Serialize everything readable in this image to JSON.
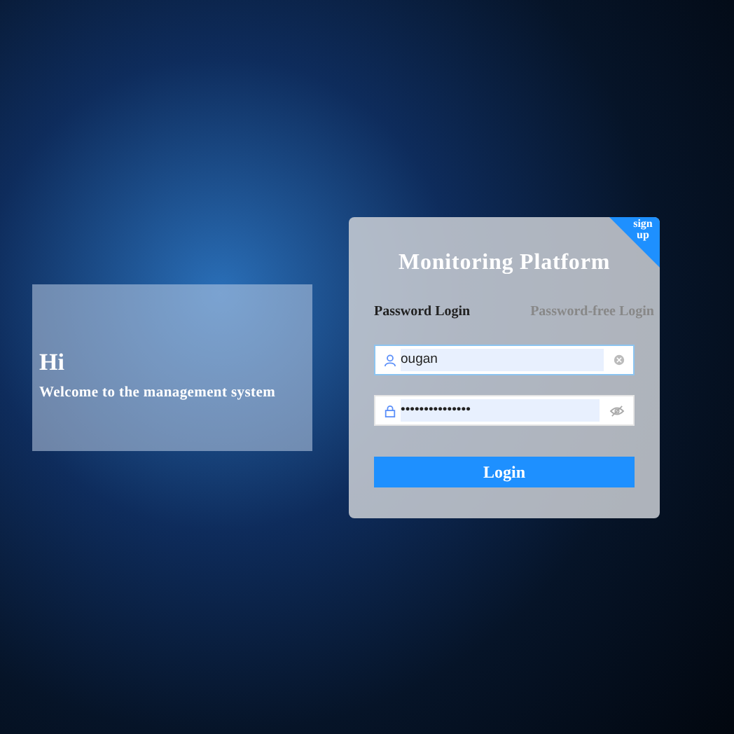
{
  "welcome": {
    "title": "Hi",
    "subtitle": "Welcome to the management system"
  },
  "login": {
    "title": "Monitoring Platform",
    "corner_link": "sign up",
    "tabs": [
      {
        "label": "Password Login",
        "selected": true
      },
      {
        "label": "Password-free Login",
        "selected": false
      }
    ],
    "username": {
      "value": "ougan"
    },
    "password": {
      "value": "•••••••••••••••"
    },
    "button": "Login"
  }
}
